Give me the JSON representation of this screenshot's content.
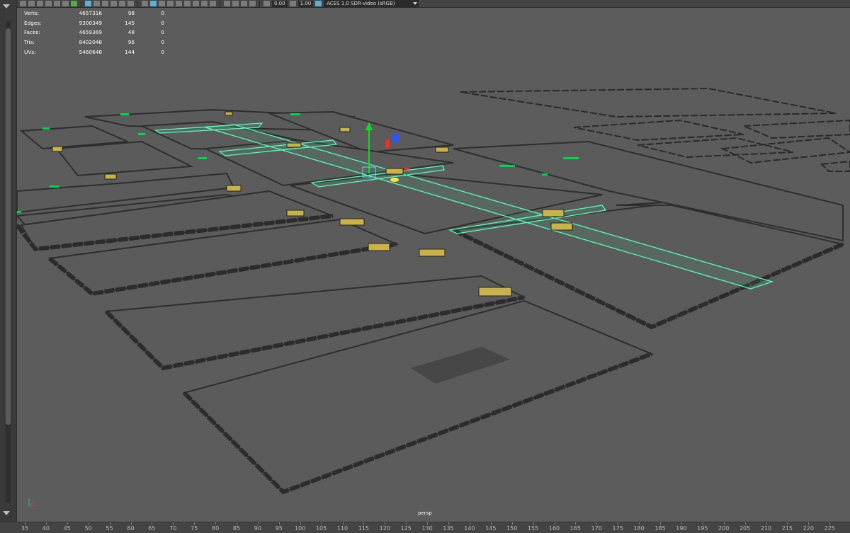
{
  "toolbar": {
    "exposure_value": "0.00",
    "gamma_value": "1.00",
    "color_space": "ACES 1.0 SDR-video (sRGB)"
  },
  "hud": {
    "rows": [
      {
        "label": "Verts:",
        "total": "4657316",
        "selected": "98",
        "extra": "0"
      },
      {
        "label": "Edges:",
        "total": "9300349",
        "selected": "145",
        "extra": "0"
      },
      {
        "label": "Faces:",
        "total": "4659369",
        "selected": "48",
        "extra": "0"
      },
      {
        "label": "Tris:",
        "total": "8402048",
        "selected": "96",
        "extra": "0"
      },
      {
        "label": "UVs:",
        "total": "5460648",
        "selected": "144",
        "extra": "0"
      }
    ]
  },
  "camera_label": "persp",
  "timeline": {
    "ticks": [
      "35",
      "40",
      "45",
      "50",
      "55",
      "60",
      "65",
      "70",
      "75",
      "80",
      "85",
      "90",
      "95",
      "100",
      "105",
      "110",
      "115",
      "120",
      "125",
      "130",
      "135",
      "140",
      "145",
      "150",
      "155",
      "160",
      "165",
      "170",
      "175",
      "180",
      "185",
      "190",
      "195",
      "200",
      "205",
      "210",
      "215",
      "220",
      "225"
    ]
  },
  "colors": {
    "viewport_bg": "#5c5c5c",
    "selection": "#52ffb8",
    "curb": "#2f2f2f",
    "accent_green": "#00d84a"
  }
}
